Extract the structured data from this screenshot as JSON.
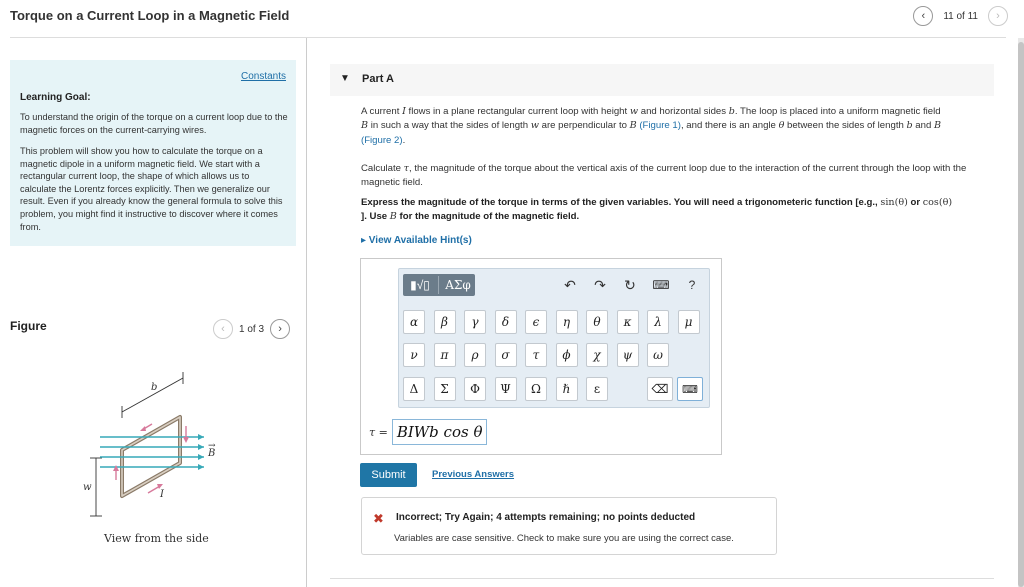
{
  "header": {
    "title": "Torque on a Current Loop in a Magnetic Field",
    "prev_icon": "‹",
    "next_icon": "›",
    "page_count": "11 of 11"
  },
  "goal": {
    "constants_link": "Constants",
    "heading": "Learning Goal:",
    "paragraph1": "To understand the origin of the torque on a current loop due to the magnetic forces on the current-carrying wires.",
    "paragraph2": "This problem will show you how to calculate the torque on a magnetic dipole in a uniform magnetic field. We start with a rectangular current loop, the shape of which allows us to calculate the Lorentz forces explicitly. Then we generalize our result. Even if you already know the general formula to solve this problem, you might find it instructive to discover where it comes from."
  },
  "figure": {
    "label": "Figure",
    "count": "1 of 3",
    "label_b": "b",
    "label_B": "B",
    "label_I": "I",
    "label_w": "w",
    "caption": "View from the side"
  },
  "part": {
    "caret": "▼",
    "title": "Part A",
    "p1_a": "A current ",
    "p1_I": "I",
    "p1_b": " flows in a plane rectangular current loop with height ",
    "p1_w": "w",
    "p1_c": " and horizontal sides ",
    "p1_bvar": "b",
    "p1_d": ". The loop is placed into a uniform magnetic field",
    "p1_B1": "B",
    "p1_e": " in such a way that the sides of length ",
    "p1_w2": "w",
    "p1_f": " are perpendicular to ",
    "p1_B2": "B",
    "p1_fig1": "(Figure 1)",
    "p1_g": ", and there is an angle ",
    "p1_theta": "θ",
    "p1_h": " between the sides of length ",
    "p1_b2": "b",
    "p1_i": " and ",
    "p1_B3": "B",
    "p1_fig2": "(Figure 2)",
    "p1_j": ".",
    "p2_a": "Calculate ",
    "p2_tau": "τ",
    "p2_b": ", the magnitude of the torque about the vertical axis of the current loop due to the interaction of the current through the loop with the magnetic field.",
    "p3_a": "Express the magnitude of the torque in terms of the given variables. You will need a trigonometeric function [e.g., ",
    "p3_sin": "sin(θ)",
    "p3_or": " or ",
    "p3_cos": "cos(θ)",
    "p3_b": "]. Use ",
    "p3_B": "B",
    "p3_c": " for the magnitude of the magnetic field.",
    "hints_link": "▸ View Available Hint(s)"
  },
  "editor": {
    "templates_label": "ΑΣφ",
    "templates_icon_label": "▮√▯",
    "tool_undo": "↶",
    "tool_redo": "↷",
    "tool_reset": "↻",
    "tool_keyboard": "⌨",
    "tool_help": "?",
    "row1": [
      "α",
      "β",
      "γ",
      "δ",
      "ϵ",
      "η",
      "θ",
      "κ",
      "λ",
      "μ"
    ],
    "row2": [
      "ν",
      "π",
      "ρ",
      "σ",
      "τ",
      "ϕ",
      "χ",
      "ψ",
      "ω"
    ],
    "row3": [
      "Δ",
      "Σ",
      "Φ",
      "Ψ",
      "Ω",
      "ℏ",
      "ε"
    ],
    "delete_key": "⌫",
    "keyboard_key": "⌨",
    "answer_lhs": "τ =",
    "answer_value": "BIWb cos θ"
  },
  "actions": {
    "submit": "Submit",
    "previous_answers": "Previous Answers"
  },
  "feedback": {
    "icon": "✖",
    "title": "Incorrect; Try Again; 4 attempts remaining; no points deducted",
    "message": "Variables are case sensitive. Check to make sure you are using the correct case."
  }
}
